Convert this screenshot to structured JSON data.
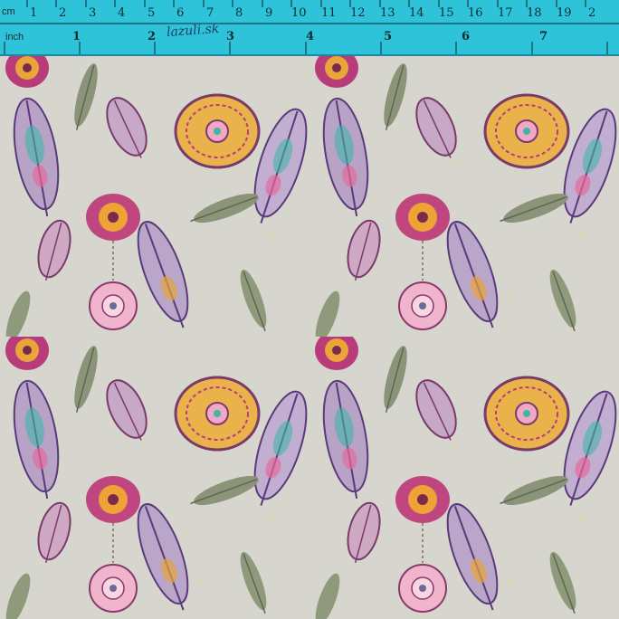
{
  "ruler": {
    "cm_unit": "cm",
    "inch_unit": "inch",
    "cm_marks": [
      "1",
      "2",
      "3",
      "4",
      "5",
      "6",
      "7",
      "8",
      "9",
      "10",
      "11",
      "12",
      "13",
      "14",
      "15",
      "16",
      "17",
      "18",
      "19",
      "2"
    ],
    "inch_marks": [
      "1",
      "2",
      "3",
      "4",
      "5",
      "6",
      "7"
    ],
    "handwritten": "lazuli.sk",
    "color": "#2fc3d9"
  },
  "fabric": {
    "background_color": "#d6d6cf",
    "motifs": [
      "feather",
      "dreamcatcher",
      "leaf"
    ],
    "palette": [
      "#b83b7a",
      "#e9a43a",
      "#6d6a9a",
      "#7f8a6f",
      "#f0a8c4",
      "#3fb5a8"
    ]
  }
}
